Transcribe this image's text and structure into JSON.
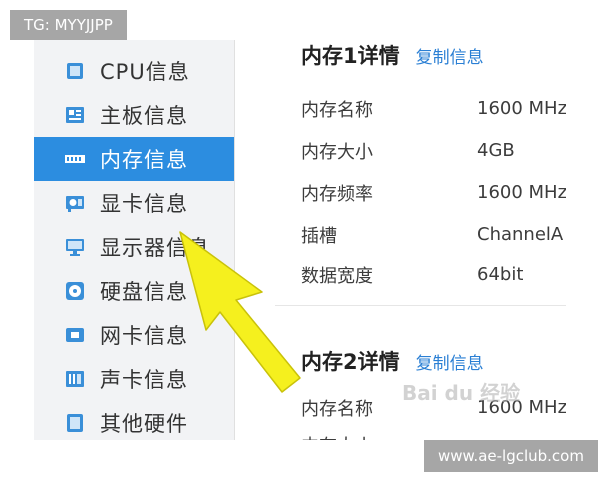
{
  "sidebar": {
    "items": [
      {
        "label": "CPU信息",
        "icon": "cpu-icon",
        "active": false
      },
      {
        "label": "主板信息",
        "icon": "motherboard-icon",
        "active": false
      },
      {
        "label": "内存信息",
        "icon": "memory-icon",
        "active": true
      },
      {
        "label": "显卡信息",
        "icon": "graphics-card-icon",
        "active": false
      },
      {
        "label": "显示器信息",
        "icon": "monitor-icon",
        "active": false
      },
      {
        "label": "硬盘信息",
        "icon": "hard-disk-icon",
        "active": false
      },
      {
        "label": "网卡信息",
        "icon": "network-card-icon",
        "active": false
      },
      {
        "label": "声卡信息",
        "icon": "sound-card-icon",
        "active": false
      },
      {
        "label": "其他硬件",
        "icon": "other-hardware-icon",
        "active": false
      }
    ]
  },
  "sections": [
    {
      "title": "内存1详情",
      "copy_label": "复制信息",
      "rows": [
        {
          "label": "内存名称",
          "value": "1600 MHz"
        },
        {
          "label": "内存大小",
          "value": "4GB"
        },
        {
          "label": "内存频率",
          "value": "1600 MHz"
        },
        {
          "label": "插槽",
          "value": "ChannelA"
        },
        {
          "label": "数据宽度",
          "value": "64bit"
        }
      ]
    },
    {
      "title": "内存2详情",
      "copy_label": "复制信息",
      "rows": [
        {
          "label": "内存名称",
          "value": "1600 MHz"
        },
        {
          "label": "内存大小",
          "value": ""
        }
      ]
    }
  ],
  "watermarks": {
    "tg": "TG: MYYJJPP",
    "url": "www.ae-lgclub.com",
    "baidu": "Bai du 经验"
  },
  "colors": {
    "accent": "#2c8de0",
    "link": "#2a7fd4",
    "sidebar_bg": "#f2f3f5",
    "arrow_fill": "#f5f01e",
    "icon": "#3a8fd8"
  }
}
